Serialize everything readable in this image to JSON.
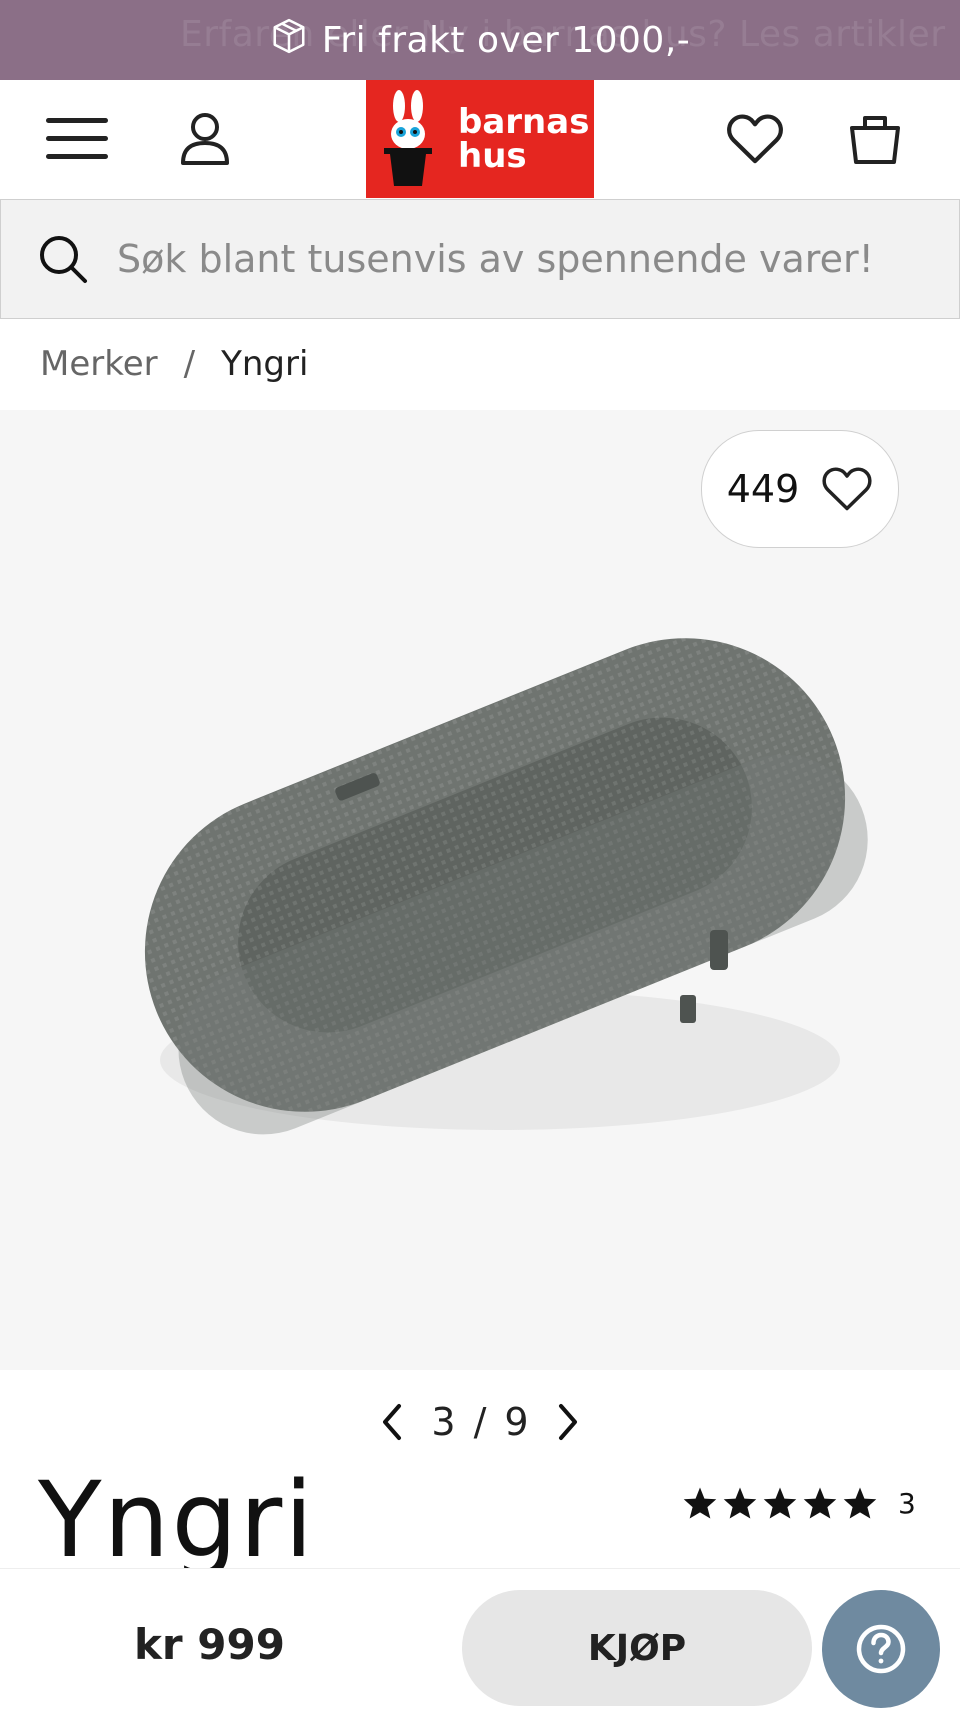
{
  "topbar": {
    "message": "Fri frakt over 1000,-",
    "background_text": "Erfaren eller Ny i barnas hus? Les artikler",
    "color": "#8b6f87"
  },
  "header": {
    "menu_icon": "hamburger-menu-icon",
    "account_icon": "user-icon",
    "logo_text_line1": "barnas",
    "logo_text_line2": "hus",
    "logo_color": "#e52620",
    "wishlist_icon": "heart-icon",
    "cart_icon": "shopping-bag-icon"
  },
  "search": {
    "placeholder": "Søk blant tusenvis av spennende varer!"
  },
  "breadcrumb": {
    "items": [
      "Merker",
      "Yngri"
    ],
    "separator": "/"
  },
  "product": {
    "favorites_count": "449",
    "image_index": "3",
    "image_total": "9",
    "pager_separator": "/",
    "brand": "Yngri",
    "rating_value": 5,
    "rating_max": 5,
    "review_count": "3"
  },
  "buybar": {
    "price": "kr 999",
    "buy_label": "KJØP",
    "help_icon": "question-icon",
    "help_color": "#6f8aa0"
  }
}
